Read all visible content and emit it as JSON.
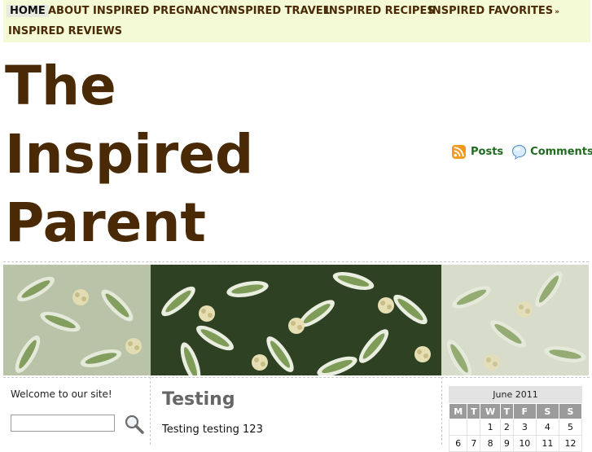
{
  "nav": {
    "items": [
      {
        "label": "HOME"
      },
      {
        "label": "ABOUT"
      },
      {
        "label": "INSPIRED PREGNANCY"
      },
      {
        "label": "INSPIRED TRAVEL"
      },
      {
        "label": "INSPIRED RECIPES"
      },
      {
        "label": "INSPIRED FAVORITES"
      },
      {
        "label": "INSPIRED REVIEWS"
      }
    ]
  },
  "header": {
    "title": "The Inspired Parent"
  },
  "feeds": {
    "posts_label": "Posts",
    "comments_label": "Comments"
  },
  "sidebar_left": {
    "welcome": "Welcome to our site!",
    "search_value": ""
  },
  "main": {
    "post_title": "Testing",
    "post_body": "Testing testing 123"
  },
  "calendar": {
    "caption": "June 2011",
    "days": [
      "M",
      "T",
      "W",
      "T",
      "F",
      "S",
      "S"
    ],
    "rows": [
      [
        "",
        "",
        "1",
        "2",
        "3",
        "4",
        "5"
      ],
      [
        "6",
        "7",
        "8",
        "9",
        "10",
        "11",
        "12"
      ]
    ]
  },
  "colors": {
    "accent": "#4a2a06",
    "nav_bg": "#f4f9d6",
    "link": "#1f6b1f"
  }
}
